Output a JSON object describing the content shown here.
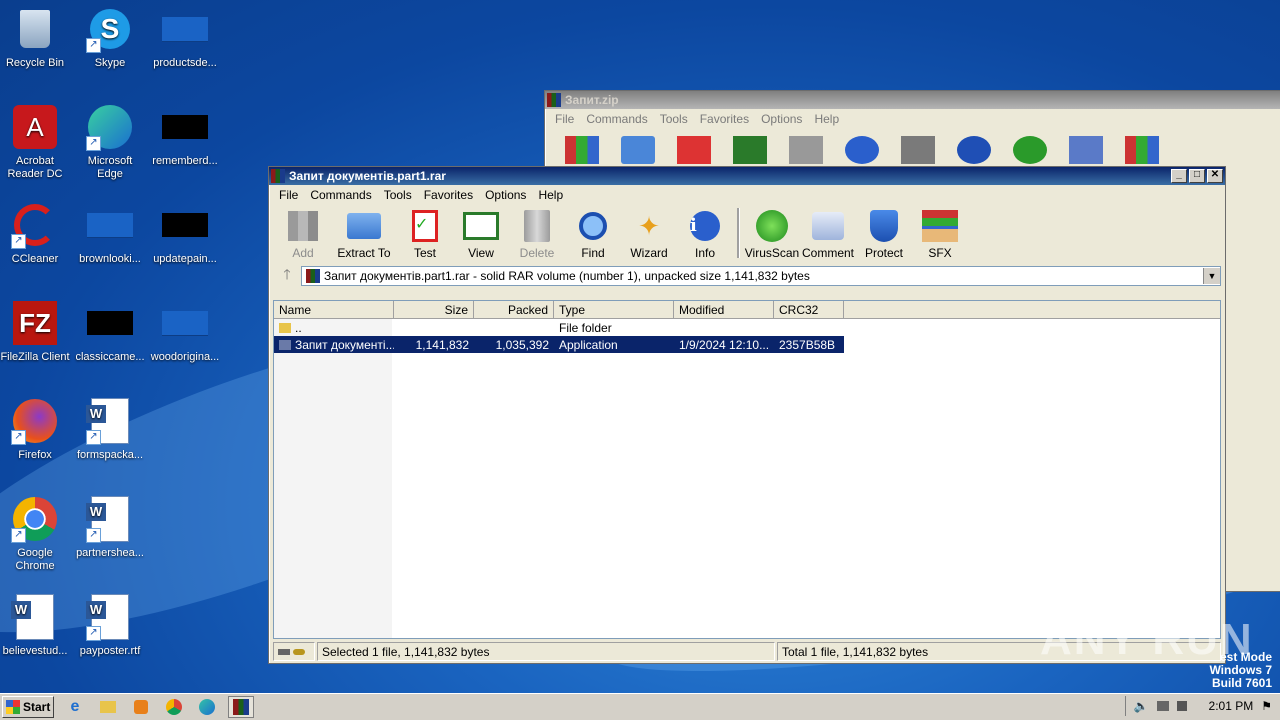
{
  "desktop": {
    "icons": [
      {
        "label": "Recycle Bin",
        "icon": "recycle-bin-icon"
      },
      {
        "label": "Skype",
        "icon": "skype-icon"
      },
      {
        "label": "productsde...",
        "icon": "file-icon"
      },
      {
        "label": "Acrobat Reader DC",
        "icon": "acrobat-icon"
      },
      {
        "label": "Microsoft Edge",
        "icon": "edge-icon"
      },
      {
        "label": "rememberd...",
        "icon": "file-icon"
      },
      {
        "label": "CCleaner",
        "icon": "ccleaner-icon"
      },
      {
        "label": "brownlooki...",
        "icon": "file-icon"
      },
      {
        "label": "updatepain...",
        "icon": "file-icon"
      },
      {
        "label": "FileZilla Client",
        "icon": "filezilla-icon"
      },
      {
        "label": "classiccame...",
        "icon": "file-icon"
      },
      {
        "label": "woodorigina...",
        "icon": "file-icon"
      },
      {
        "label": "Firefox",
        "icon": "firefox-icon"
      },
      {
        "label": "formspacka...",
        "icon": "word-doc-icon"
      },
      {
        "label": "Google Chrome",
        "icon": "chrome-icon"
      },
      {
        "label": "partnershea...",
        "icon": "word-doc-icon"
      },
      {
        "label": "believestud...",
        "icon": "word-doc-icon"
      },
      {
        "label": "payposter.rtf",
        "icon": "word-doc-icon"
      }
    ]
  },
  "back_window": {
    "title": "Запит.zip",
    "menu": [
      "File",
      "Commands",
      "Tools",
      "Favorites",
      "Options",
      "Help"
    ]
  },
  "main_window": {
    "title": "Запит документів.part1.rar",
    "menu": [
      "File",
      "Commands",
      "Tools",
      "Favorites",
      "Options",
      "Help"
    ],
    "toolbar": [
      {
        "label": "Add",
        "icon": "add-archive-icon",
        "disabled": true
      },
      {
        "label": "Extract To",
        "icon": "extract-folder-icon",
        "disabled": false
      },
      {
        "label": "Test",
        "icon": "test-clipboard-icon",
        "disabled": false
      },
      {
        "label": "View",
        "icon": "view-book-icon",
        "disabled": false
      },
      {
        "label": "Delete",
        "icon": "delete-trash-icon",
        "disabled": true
      },
      {
        "label": "Find",
        "icon": "find-magnifier-icon",
        "disabled": false
      },
      {
        "label": "Wizard",
        "icon": "wizard-wand-icon",
        "disabled": false
      },
      {
        "label": "Info",
        "icon": "info-icon",
        "disabled": false
      },
      {
        "label": "VirusScan",
        "icon": "virus-scan-icon",
        "disabled": false
      },
      {
        "label": "Comment",
        "icon": "comment-icon",
        "disabled": false
      },
      {
        "label": "Protect",
        "icon": "protect-shield-icon",
        "disabled": false
      },
      {
        "label": "SFX",
        "icon": "sfx-box-icon",
        "disabled": false
      }
    ],
    "address": "Запит документів.part1.rar - solid RAR volume (number 1), unpacked size 1,141,832 bytes",
    "columns": [
      "Name",
      "Size",
      "Packed",
      "Type",
      "Modified",
      "CRC32"
    ],
    "rows": [
      {
        "name": "..",
        "size": "",
        "packed": "",
        "type": "File folder",
        "modified": "",
        "crc": ""
      },
      {
        "name": "Запит документі...",
        "size": "1,141,832",
        "packed": "1,035,392",
        "type": "Application",
        "modified": "1/9/2024 12:10...",
        "crc": "2357B58B"
      }
    ],
    "status_left": "Selected 1 file, 1,141,832 bytes",
    "status_right": "Total 1 file, 1,141,832 bytes"
  },
  "taskbar": {
    "start_label": "Start",
    "time": "2:01 PM"
  },
  "watermark": {
    "line1": "est Mode",
    "line2": "Windows 7",
    "line3": "Build 7601",
    "brand": "ANY RUN"
  }
}
